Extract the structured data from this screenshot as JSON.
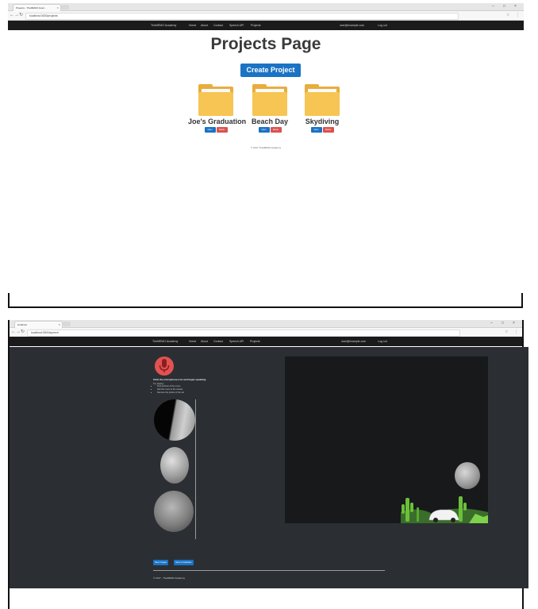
{
  "top_window": {
    "tab_title": "Projects - TheMEMO Acad...",
    "url": "localhost:3000/projects",
    "nav": {
      "brand": "TheMEMO Academy",
      "links": [
        "Home",
        "About",
        "Contact",
        "Speech API",
        "Projects"
      ],
      "user": "user@example.com",
      "logout": "Log out"
    },
    "page_title": "Projects Page",
    "create_button": "Create Project",
    "projects": [
      {
        "name": "Joe's Graduation",
        "open": "Open",
        "delete": "Delete"
      },
      {
        "name": "Beach Day",
        "open": "Open",
        "delete": "Delete"
      },
      {
        "name": "Skydiving",
        "open": "Open",
        "delete": "Delete"
      }
    ],
    "footer": "© 2017 TheMEMO Academy"
  },
  "bottom_window": {
    "tab_title": "localhost",
    "url": "localhost:3000/speech",
    "nav": {
      "brand": "TheMEMO Academy",
      "links": [
        "Home",
        "About",
        "Contact",
        "Speech API",
        "Projects"
      ],
      "user": "user@example.com",
      "logout": "Log out"
    },
    "panel_title": "Click the microphone icon and begin speaking",
    "panel_sub": "Try saying:",
    "instructions": [
      "Find pictures of the moon",
      "Add the moon to the canvas",
      "Remove the picture of the car"
    ],
    "buttons": [
      "Save Images",
      "Save to Database"
    ],
    "footer": "© 2017 - TheMEMO Academy"
  },
  "icons": {
    "microphone": "microphone-icon",
    "folder": "folder-icon",
    "back": "back-arrow-icon",
    "forward": "forward-arrow-icon",
    "reload": "reload-icon",
    "star": "star-icon",
    "menu": "kebab-menu-icon"
  },
  "colors": {
    "primary": "#1a73c4",
    "danger": "#d9534f",
    "folder": "#f7c553",
    "mic": "#e25252",
    "dark_bg": "#2b2f33",
    "navbar": "#1b1b1b"
  }
}
